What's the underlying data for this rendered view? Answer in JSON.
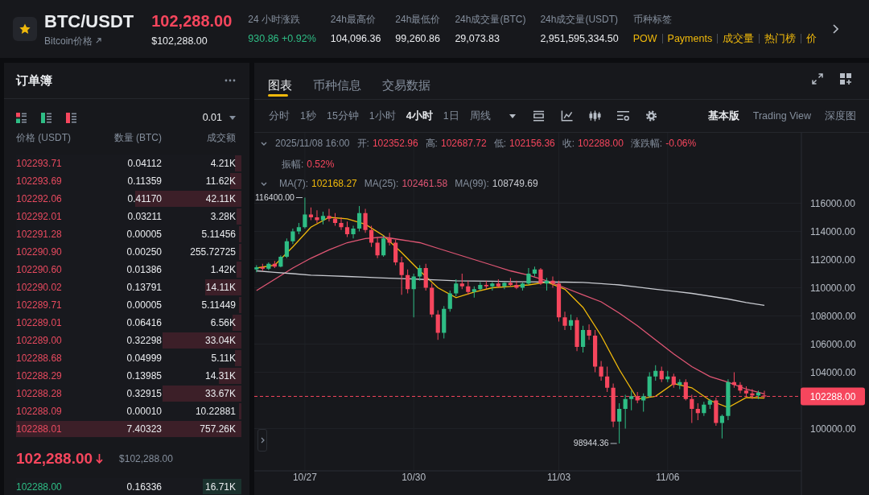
{
  "header": {
    "pair": "BTC/USDT",
    "coin_link": "Bitcoin价格",
    "price": "102,288.00",
    "falling": true,
    "price_usd": "$102,288.00",
    "stats": [
      {
        "label": "24 小时涨跌",
        "value": "930.86 +0.92%",
        "kind": "change"
      },
      {
        "label": "24h最高价",
        "value": "104,096.36",
        "kind": "value"
      },
      {
        "label": "24h最低价",
        "value": "99,260.86",
        "kind": "value"
      },
      {
        "label": "24h成交量(BTC)",
        "value": "29,073.83",
        "kind": "value"
      },
      {
        "label": "24h成交量(USDT)",
        "value": "2,951,595,334.50",
        "kind": "value"
      }
    ],
    "tags_label": "币种标签",
    "tags": [
      "POW",
      "Payments",
      "成交量",
      "热门榜",
      "价"
    ]
  },
  "order_book": {
    "title": "订单簿",
    "precision": "0.01",
    "columns": [
      "价格 (USDT)",
      "数量 (BTC)",
      "成交额"
    ],
    "asks": [
      {
        "price": "102293.71",
        "amount": "0.04112",
        "total": "4.21K",
        "level": 0.03
      },
      {
        "price": "102293.69",
        "amount": "0.11359",
        "total": "11.62K",
        "level": 0.05
      },
      {
        "price": "102292.06",
        "amount": "0.41170",
        "total": "42.11K",
        "level": 0.47
      },
      {
        "price": "102292.01",
        "amount": "0.03211",
        "total": "3.28K",
        "level": 0.02
      },
      {
        "price": "102291.28",
        "amount": "0.00005",
        "total": "5.11456",
        "level": 0.01
      },
      {
        "price": "102290.90",
        "amount": "0.00250",
        "total": "255.72725",
        "level": 0.01
      },
      {
        "price": "102290.60",
        "amount": "0.01386",
        "total": "1.42K",
        "level": 0.02
      },
      {
        "price": "102290.02",
        "amount": "0.13791",
        "total": "14.11K",
        "level": 0.16
      },
      {
        "price": "102289.71",
        "amount": "0.00005",
        "total": "5.11449",
        "level": 0.01
      },
      {
        "price": "102289.01",
        "amount": "0.06416",
        "total": "6.56K",
        "level": 0.04
      },
      {
        "price": "102289.00",
        "amount": "0.32298",
        "total": "33.04K",
        "level": 0.35
      },
      {
        "price": "102288.68",
        "amount": "0.04999",
        "total": "5.11K",
        "level": 0.03
      },
      {
        "price": "102288.29",
        "amount": "0.13985",
        "total": "14.31K",
        "level": 0.1
      },
      {
        "price": "102288.28",
        "amount": "0.32915",
        "total": "33.67K",
        "level": 0.35
      },
      {
        "price": "102288.09",
        "amount": "0.00010",
        "total": "10.22881",
        "level": 0.01
      },
      {
        "price": "102288.01",
        "amount": "7.40323",
        "total": "757.26K",
        "level": 1
      }
    ],
    "last_price": "102,288.00",
    "falling": true,
    "last_price_usd": "$102,288.00",
    "bids": [
      {
        "price": "102288.00",
        "amount": "0.16336",
        "total": "16.71K",
        "level": 0.17
      }
    ]
  },
  "chart_panel": {
    "tabs": [
      {
        "label": "图表",
        "selected": true
      },
      {
        "label": "币种信息",
        "selected": false
      },
      {
        "label": "交易数据",
        "selected": false
      }
    ],
    "intervals": [
      {
        "label": "分时",
        "selected": false
      },
      {
        "label": "1秒",
        "selected": false
      },
      {
        "label": "15分钟",
        "selected": false
      },
      {
        "label": "1小时",
        "selected": false
      },
      {
        "label": "4小时",
        "selected": true
      },
      {
        "label": "1日",
        "selected": false
      },
      {
        "label": "周线",
        "selected": false
      }
    ],
    "views": [
      {
        "label": "基本版",
        "selected": true
      },
      {
        "label": "Trading View",
        "selected": false
      },
      {
        "label": "深度图",
        "selected": false
      }
    ],
    "ohlc_legend": {
      "time": "2025/11/08 16:00",
      "falling": true,
      "items": [
        {
          "label": "开:",
          "value": "102352.96"
        },
        {
          "label": "高:",
          "value": "102687.72"
        },
        {
          "label": "低:",
          "value": "102156.36"
        },
        {
          "label": "收:",
          "value": "102288.00"
        },
        {
          "label": "涨跌幅:",
          "value": "-0.06%"
        }
      ],
      "amplitude_label": "振幅:",
      "amplitude": "0.52%"
    },
    "ma_legend": [
      {
        "label": "MA(7):",
        "value": "102168.27",
        "color": "#f0b90b"
      },
      {
        "label": "MA(25):",
        "value": "102461.58",
        "color": "#e05674"
      },
      {
        "label": "MA(99):",
        "value": "108749.69",
        "color": "#c8cad0"
      }
    ],
    "chart_data": [
      {
        "type": "candlestick",
        "x": [
          "2025-10-25T16:00",
          "2025-10-25T20:00",
          "2025-10-26T00:00",
          "2025-10-26T04:00",
          "2025-10-26T08:00",
          "2025-10-26T12:00",
          "2025-10-26T16:00",
          "2025-10-26T20:00",
          "2025-10-27T00:00",
          "2025-10-27T04:00",
          "2025-10-27T08:00",
          "2025-10-27T12:00",
          "2025-10-27T16:00",
          "2025-10-27T20:00",
          "2025-10-28T00:00",
          "2025-10-28T04:00",
          "2025-10-28T08:00",
          "2025-10-28T12:00",
          "2025-10-28T16:00",
          "2025-10-28T20:00",
          "2025-10-29T00:00",
          "2025-10-29T04:00",
          "2025-10-29T08:00",
          "2025-10-29T12:00",
          "2025-10-29T16:00",
          "2025-10-29T20:00",
          "2025-10-30T00:00",
          "2025-10-30T04:00",
          "2025-10-30T08:00",
          "2025-10-30T12:00",
          "2025-10-30T16:00",
          "2025-10-30T20:00",
          "2025-10-31T00:00",
          "2025-10-31T04:00",
          "2025-10-31T08:00",
          "2025-10-31T12:00",
          "2025-10-31T16:00",
          "2025-10-31T20:00",
          "2025-11-01T00:00",
          "2025-11-01T04:00",
          "2025-11-01T08:00",
          "2025-11-01T12:00",
          "2025-11-01T16:00",
          "2025-11-01T20:00",
          "2025-11-02T00:00",
          "2025-11-02T04:00",
          "2025-11-02T08:00",
          "2025-11-02T12:00",
          "2025-11-02T16:00",
          "2025-11-02T20:00",
          "2025-11-03T00:00",
          "2025-11-03T04:00",
          "2025-11-03T08:00",
          "2025-11-03T12:00",
          "2025-11-03T16:00",
          "2025-11-03T20:00",
          "2025-11-04T00:00",
          "2025-11-04T04:00",
          "2025-11-04T08:00",
          "2025-11-04T12:00",
          "2025-11-04T16:00",
          "2025-11-04T20:00",
          "2025-11-05T00:00",
          "2025-11-05T04:00",
          "2025-11-05T08:00",
          "2025-11-05T12:00",
          "2025-11-05T16:00",
          "2025-11-05T20:00",
          "2025-11-06T00:00",
          "2025-11-06T04:00",
          "2025-11-06T08:00",
          "2025-11-06T12:00",
          "2025-11-06T16:00",
          "2025-11-06T20:00",
          "2025-11-07T00:00",
          "2025-11-07T04:00",
          "2025-11-07T08:00",
          "2025-11-07T12:00",
          "2025-11-07T16:00",
          "2025-11-07T20:00",
          "2025-11-08T00:00",
          "2025-11-08T04:00",
          "2025-11-08T08:00",
          "2025-11-08T12:00",
          "2025-11-08T16:00"
        ],
        "ohlc": [
          [
            111300,
            111600,
            111100,
            111450
          ],
          [
            111450,
            111700,
            111200,
            111350
          ],
          [
            111350,
            111800,
            111250,
            111700
          ],
          [
            111700,
            111900,
            111400,
            111500
          ],
          [
            111500,
            112300,
            111450,
            112200
          ],
          [
            112200,
            113500,
            112100,
            113300
          ],
          [
            113300,
            114200,
            113100,
            114000
          ],
          [
            114000,
            114600,
            113800,
            114300
          ],
          [
            114300,
            116400,
            114200,
            115200
          ],
          [
            115200,
            115700,
            114800,
            115000
          ],
          [
            115000,
            115500,
            114600,
            114800
          ],
          [
            114800,
            115400,
            114500,
            115100
          ],
          [
            115100,
            115600,
            114700,
            114900
          ],
          [
            114900,
            115300,
            114400,
            114600
          ],
          [
            114600,
            115000,
            114100,
            114300
          ],
          [
            114300,
            114700,
            113600,
            113800
          ],
          [
            113800,
            114400,
            113500,
            114200
          ],
          [
            114200,
            115800,
            114000,
            115300
          ],
          [
            115300,
            115600,
            113900,
            114100
          ],
          [
            114100,
            114400,
            112900,
            113200
          ],
          [
            113200,
            113600,
            112100,
            112300
          ],
          [
            112300,
            113700,
            112200,
            113500
          ],
          [
            113500,
            113900,
            113000,
            113200
          ],
          [
            113200,
            113400,
            111600,
            111800
          ],
          [
            111800,
            112200,
            109500,
            110900
          ],
          [
            110900,
            111300,
            109600,
            109900
          ],
          [
            109900,
            111000,
            107900,
            110800
          ],
          [
            110800,
            111600,
            110500,
            111400
          ],
          [
            111400,
            111700,
            109800,
            110000
          ],
          [
            110000,
            110300,
            107900,
            108100
          ],
          [
            108100,
            108400,
            106300,
            106800
          ],
          [
            106800,
            108700,
            106400,
            108500
          ],
          [
            108500,
            109800,
            108300,
            109600
          ],
          [
            109600,
            110600,
            109400,
            110300
          ],
          [
            110300,
            111000,
            109900,
            110100
          ],
          [
            110100,
            110500,
            109500,
            109700
          ],
          [
            109700,
            110100,
            109300,
            109900
          ],
          [
            109900,
            110400,
            109800,
            110200
          ],
          [
            110200,
            110500,
            109900,
            110100
          ],
          [
            110100,
            110400,
            109800,
            110300
          ],
          [
            110300,
            110600,
            110000,
            110100
          ],
          [
            110100,
            110400,
            109900,
            110350
          ],
          [
            110350,
            110700,
            110100,
            110200
          ],
          [
            110200,
            110500,
            109900,
            110000
          ],
          [
            110000,
            110400,
            109800,
            110300
          ],
          [
            110300,
            111400,
            110200,
            111000
          ],
          [
            111000,
            111500,
            110800,
            111300
          ],
          [
            111300,
            111400,
            110200,
            110300
          ],
          [
            110300,
            110700,
            109800,
            110500
          ],
          [
            110500,
            110800,
            110000,
            110300
          ],
          [
            110300,
            110500,
            107600,
            107900
          ],
          [
            107900,
            108300,
            107000,
            107300
          ],
          [
            107300,
            108100,
            107000,
            107700
          ],
          [
            107700,
            107900,
            105500,
            105800
          ],
          [
            105800,
            107300,
            105400,
            107000
          ],
          [
            107000,
            107400,
            106300,
            106600
          ],
          [
            106600,
            107000,
            104000,
            104400
          ],
          [
            104400,
            104800,
            103400,
            103700
          ],
          [
            103700,
            104400,
            102600,
            102900
          ],
          [
            102900,
            103200,
            100100,
            100500
          ],
          [
            100500,
            101800,
            98944.36,
            101400
          ],
          [
            101400,
            102400,
            100000,
            102100
          ],
          [
            102100,
            102700,
            101300,
            102300
          ],
          [
            102300,
            102600,
            101800,
            102000
          ],
          [
            102000,
            102500,
            101200,
            102300
          ],
          [
            102300,
            104000,
            102200,
            103700
          ],
          [
            103700,
            104500,
            103400,
            104100
          ],
          [
            104100,
            104400,
            103300,
            103500
          ],
          [
            103500,
            104100,
            103300,
            103700
          ],
          [
            103700,
            103900,
            102900,
            103100
          ],
          [
            103100,
            103500,
            102800,
            103300
          ],
          [
            103300,
            103500,
            102000,
            102100
          ],
          [
            102100,
            102400,
            100400,
            101400
          ],
          [
            101400,
            101800,
            100600,
            101100
          ],
          [
            101100,
            101900,
            100900,
            101700
          ],
          [
            101700,
            102100,
            101400,
            102000
          ],
          [
            102000,
            102200,
            100200,
            100400
          ],
          [
            100400,
            101000,
            99300,
            100900
          ],
          [
            100900,
            103500,
            100600,
            103300
          ],
          [
            103300,
            104000,
            102900,
            103100
          ],
          [
            103100,
            103300,
            102500,
            102700
          ],
          [
            102700,
            103000,
            102300,
            102500
          ],
          [
            102500,
            102800,
            102100,
            102350
          ],
          [
            102350,
            102700,
            102100,
            102550
          ],
          [
            102352.96,
            102687.72,
            102156.36,
            102288
          ]
        ],
        "series": [
          {
            "type": "line",
            "color": "#f0b90b",
            "x": [
              "2025-10-25T16:00",
              "2025-10-26T04:00",
              "2025-10-26T16:00",
              "2025-10-27T04:00",
              "2025-10-27T16:00",
              "2025-10-28T04:00",
              "2025-10-28T16:00",
              "2025-10-29T04:00",
              "2025-10-29T16:00",
              "2025-10-30T04:00",
              "2025-10-30T16:00",
              "2025-10-31T04:00",
              "2025-10-31T16:00",
              "2025-11-01T04:00",
              "2025-11-01T16:00",
              "2025-11-02T04:00",
              "2025-11-02T16:00",
              "2025-11-03T04:00",
              "2025-11-03T16:00",
              "2025-11-04T04:00",
              "2025-11-04T16:00",
              "2025-11-05T04:00",
              "2025-11-05T16:00",
              "2025-11-06T04:00",
              "2025-11-06T16:00",
              "2025-11-07T04:00",
              "2025-11-07T16:00",
              "2025-11-08T04:00",
              "2025-11-08T16:00"
            ],
            "values": [
              111400,
              111600,
              112900,
              114300,
              115000,
              114900,
              114500,
              113700,
              112500,
              111200,
              110000,
              109300,
              109700,
              110000,
              110100,
              110200,
              110400,
              109900,
              108600,
              106600,
              104200,
              102100,
              102300,
              103200,
              102900,
              102000,
              101500,
              102200,
              102170
            ]
          },
          {
            "type": "line",
            "color": "#e05674",
            "x": [
              "2025-10-25T16:00",
              "2025-10-26T04:00",
              "2025-10-26T16:00",
              "2025-10-27T04:00",
              "2025-10-27T16:00",
              "2025-10-28T04:00",
              "2025-10-28T16:00",
              "2025-10-29T04:00",
              "2025-10-29T16:00",
              "2025-10-30T04:00",
              "2025-10-30T16:00",
              "2025-10-31T04:00",
              "2025-10-31T16:00",
              "2025-11-01T04:00",
              "2025-11-01T16:00",
              "2025-11-02T04:00",
              "2025-11-02T16:00",
              "2025-11-03T04:00",
              "2025-11-03T16:00",
              "2025-11-04T04:00",
              "2025-11-04T16:00",
              "2025-11-05T04:00",
              "2025-11-05T16:00",
              "2025-11-06T04:00",
              "2025-11-06T16:00",
              "2025-11-07T04:00",
              "2025-11-07T16:00",
              "2025-11-08T04:00",
              "2025-11-08T16:00"
            ],
            "values": [
              109800,
              110600,
              111400,
              112100,
              112700,
              113200,
              113500,
              113600,
              113400,
              113200,
              112800,
              112400,
              112000,
              111600,
              111200,
              110900,
              110500,
              110000,
              109500,
              109000,
              108200,
              107300,
              106300,
              105300,
              104400,
              103700,
              103300,
              102800,
              102460
            ]
          },
          {
            "type": "line",
            "color": "#c8cad0",
            "x": [
              "2025-10-25T16:00",
              "2025-10-26T04:00",
              "2025-10-26T16:00",
              "2025-10-27T04:00",
              "2025-10-27T16:00",
              "2025-10-28T04:00",
              "2025-10-28T16:00",
              "2025-10-29T04:00",
              "2025-10-29T16:00",
              "2025-10-30T04:00",
              "2025-10-30T16:00",
              "2025-10-31T04:00",
              "2025-10-31T16:00",
              "2025-11-01T04:00",
              "2025-11-01T16:00",
              "2025-11-02T04:00",
              "2025-11-02T16:00",
              "2025-11-03T04:00",
              "2025-11-03T16:00",
              "2025-11-04T04:00",
              "2025-11-04T16:00",
              "2025-11-05T04:00",
              "2025-11-05T16:00",
              "2025-11-06T04:00",
              "2025-11-06T16:00",
              "2025-11-07T04:00",
              "2025-11-07T16:00",
              "2025-11-08T04:00",
              "2025-11-08T16:00"
            ],
            "values": [
              111200,
              111100,
              111000,
              110900,
              110850,
              110800,
              110750,
              110700,
              110650,
              110600,
              110550,
              110500,
              110480,
              110460,
              110440,
              110420,
              110400,
              110400,
              110380,
              110300,
              110200,
              110050,
              109900,
              109750,
              109600,
              109400,
              109200,
              108950,
              108750
            ]
          }
        ],
        "xlim": [
          "2025-10-25T14:30",
          "2025-11-09T16:30"
        ],
        "ylim": [
          97000,
          121000
        ],
        "xticks": [
          {
            "value": "2025-10-27",
            "label": "10/27"
          },
          {
            "value": "2025-10-30",
            "label": "10/30"
          },
          {
            "value": "2025-11-03",
            "label": "11/03"
          },
          {
            "value": "2025-11-06",
            "label": "11/06"
          }
        ],
        "yticks": [
          {
            "value": 100000,
            "label": "100000.00"
          },
          {
            "value": 104000,
            "label": "104000.00"
          },
          {
            "value": 106000,
            "label": "106000.00"
          },
          {
            "value": 108000,
            "label": "108000.00"
          },
          {
            "value": 110000,
            "label": "110000.00"
          },
          {
            "value": 112000,
            "label": "112000.00"
          },
          {
            "value": 114000,
            "label": "114000.00"
          },
          {
            "value": 116000,
            "label": "116000.00"
          }
        ],
        "ref_lines": [
          {
            "axis": "y",
            "value": 102288,
            "label": "102288.00",
            "color": "#f6465d",
            "line_style": "dashed"
          }
        ],
        "annotations": [
          "116400.00",
          "98944.36"
        ],
        "grid": true
      }
    ]
  }
}
